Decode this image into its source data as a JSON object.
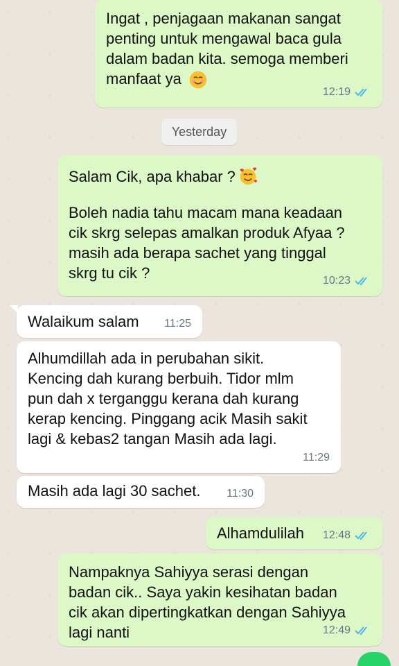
{
  "colors": {
    "background": "#ece5dd",
    "outgoing_bubble": "#dcf8c6",
    "incoming_bubble": "#ffffff",
    "read_tick": "#4fb6ec",
    "timestamp": "#667781"
  },
  "date_separator": "Yesterday",
  "messages": [
    {
      "direction": "outgoing",
      "text": "Ingat , penjagaan makanan sangat\npenting untuk mengawal baca gula\ndalam badan kita. semoga memberi\nmanfaat ya",
      "emoji": "smiling-face-icon",
      "time": "12:19",
      "status": "read"
    },
    {
      "direction": "outgoing",
      "text": "Salam Cik, apa khabar ?",
      "emoji": "smiling-face-with-hearts-icon",
      "time": "",
      "status": ""
    },
    {
      "direction": "outgoing",
      "text": "Boleh nadia tahu macam mana keadaan\ncik skrg selepas amalkan produk Afyaa ?\nmasih ada berapa sachet yang tinggal\nskrg tu cik ?",
      "time": "10:23",
      "status": "read"
    },
    {
      "direction": "incoming",
      "text": "Walaikum salam",
      "time": "11:25"
    },
    {
      "direction": "incoming",
      "text": "Alhumdillah ada in perubahan sikit.\nKencing dah kurang berbuih. Tidor mlm\npun dah x terganggu kerana dah kurang\nkerap kencing. Pinggang acik Masih sakit\nlagi & kebas2 tangan Masih ada lagi.",
      "time": "11:29"
    },
    {
      "direction": "incoming",
      "text": "Masih ada lagi 30 sachet.",
      "time": "11:30"
    },
    {
      "direction": "outgoing",
      "text": "Alhamdulilah",
      "time": "12:48",
      "status": "read"
    },
    {
      "direction": "outgoing",
      "text": "Nampaknya Sahiyya serasi dengan\nbadan cik.. Saya yakin kesihatan badan\ncik akan dipertingkatkan dengan Sahiyya\nlagi nanti",
      "time": "12:49",
      "status": "read"
    }
  ]
}
